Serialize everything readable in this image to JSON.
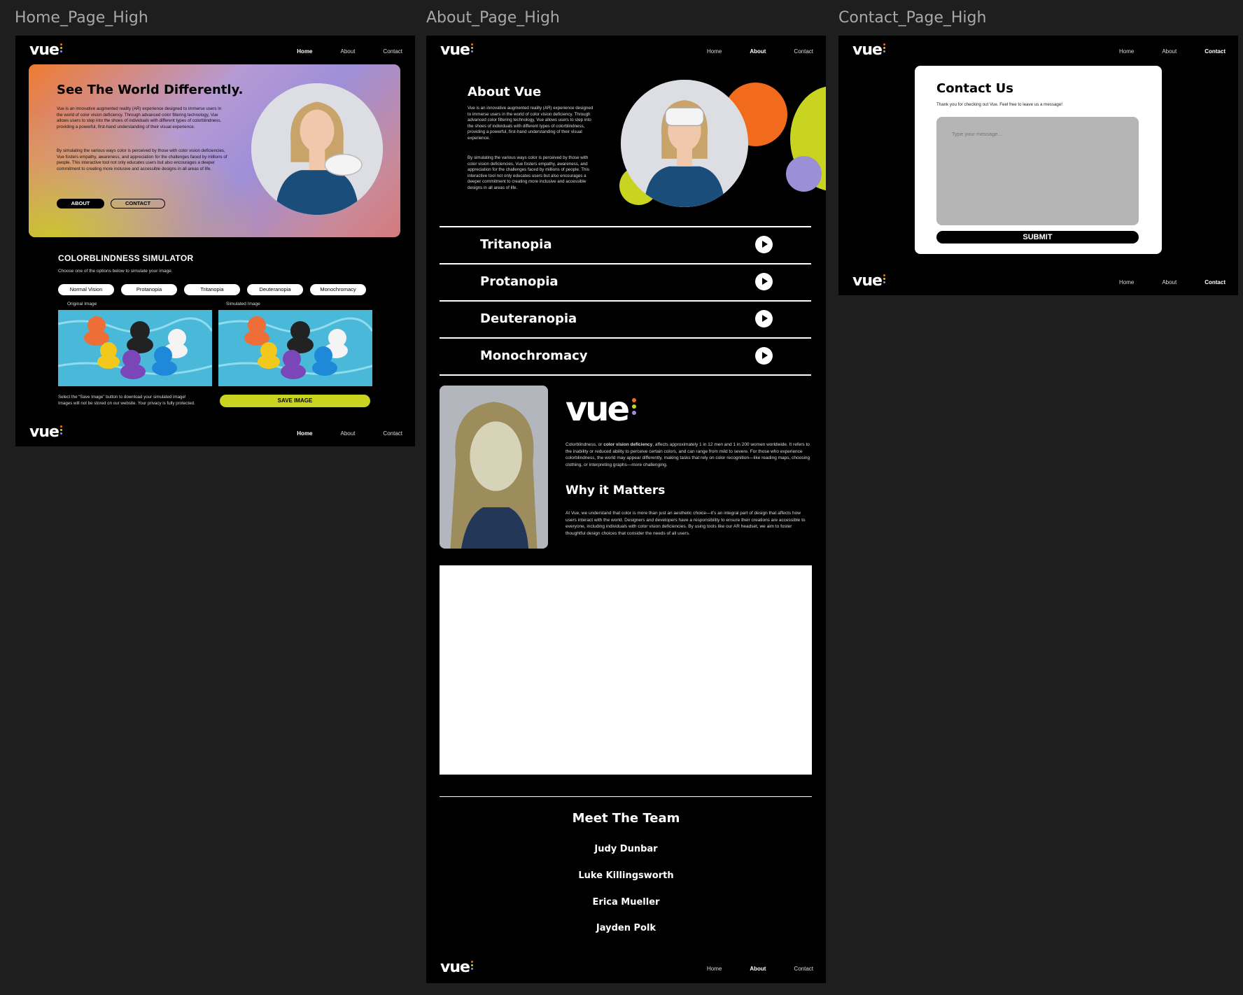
{
  "frames": {
    "home_label": "Home_Page_High",
    "about_label": "About_Page_High",
    "contact_label": "Contact_Page_High"
  },
  "brand": {
    "logo": "vue",
    "dot_colors": [
      "#f26b1d",
      "#c8d41f",
      "#9b8fd8"
    ]
  },
  "nav": {
    "home": "Home",
    "about": "About",
    "contact": "Contact"
  },
  "home": {
    "hero_title": "See The World Differently.",
    "hero_p1": "Vue is an innovative augmented reality (AR) experience designed to immerse users in the world of color vision deficiency. Through advanced color filtering technology, Vue allows users to step into the shoes of individuals with different types of colorblindness, providing a powerful, first-hand understanding of their visual experience.",
    "hero_p2": "By simulating the various ways color is perceived by those with color vision deficiencies, Vue fosters empathy, awareness, and appreciation for the challenges faced by millions of people. This interactive tool not only educates users but also encourages a deeper commitment to creating more inclusive and accessible designs in all areas of life.",
    "btn_about": "ABOUT",
    "btn_contact": "CONTACT",
    "sim_title": "COLORBLINDNESS SIMULATOR",
    "sim_sub": "Choose one of the options below to simulate your image.",
    "options": [
      "Normal Vision",
      "Protanopia",
      "Tritanopia",
      "Deuteranopia",
      "Monochromacy"
    ],
    "original_label": "Original Image",
    "simulated_label": "Simulated Image",
    "save_note_1": "Select the “Save Image” button to download your simulated image!",
    "save_note_2": "Images will not be stored on our website. Your privacy is fully protected.",
    "save_btn": "SAVE IMAGE"
  },
  "about": {
    "title": "About Vue",
    "p1": "Vue is an innovative augmented reality (AR) experience designed to immerse users in the world of color vision deficiency. Through advanced color filtering technology, Vue allows users to step into the shoes of individuals with different types of colorblindness, providing a powerful, first-hand understanding of their visual experience.",
    "p2": "By simulating the various ways color is perceived by those with color vision deficiencies, Vue fosters empathy, awareness, and appreciation for the challenges faced by millions of people. This interactive tool not only educates users but also encourages a deeper commitment to creating more inclusive and accessible designs in all areas of life.",
    "types": [
      "Tritanopia",
      "Protanopia",
      "Deuteranopia",
      "Monochromacy"
    ],
    "bio_pre": "Colorblindness, or ",
    "bio_bold": "color vision deficiency",
    "bio_post": ", affects approximately 1 in 12 men and 1 in 200 women worldwide. It refers to the inability or reduced ability to perceive certain colors, and can range from mild to severe. For those who experience colorblindness, the world may appear differently, making tasks that rely on color recognition—like reading maps, choosing clothing, or interpreting graphs—more challenging.",
    "why_title": "Why it Matters",
    "why_text": "At Vue, we understand that color is more than just an aesthetic choice—it’s an integral part of design that affects how users interact with the world. Designers and developers have a responsibility to ensure their creations are accessible to everyone, including individuals with color vision deficiencies. By using tools like our AR headset, we aim to foster thoughtful design choices that consider the needs of all users.",
    "team_title": "Meet The Team",
    "team": [
      "Judy Dunbar",
      "Luke Killingsworth",
      "Erica Mueller",
      "Jayden Polk"
    ]
  },
  "contact": {
    "title": "Contact Us",
    "thanks": "Thank you for checking out Vue. Feel free to leave us a message!",
    "placeholder": "Type your message...",
    "submit": "SUBMIT"
  }
}
